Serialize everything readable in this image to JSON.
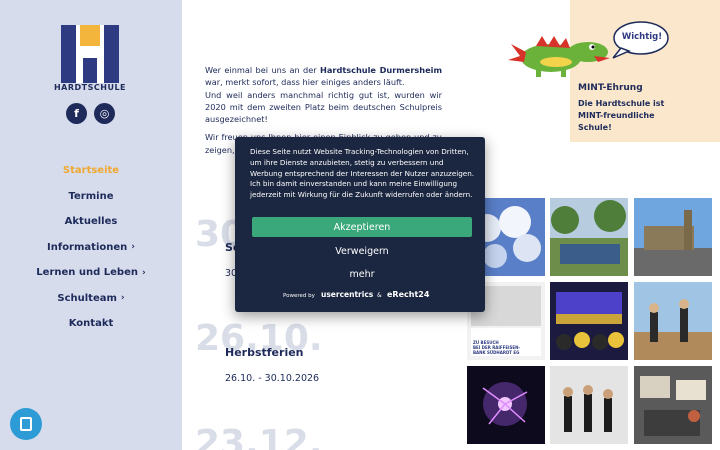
{
  "sidebar": {
    "logo_text": "HARDTSCHULE",
    "social": [
      {
        "icon": "facebook-icon",
        "glyph": "f"
      },
      {
        "icon": "instagram-icon",
        "glyph": "◎"
      }
    ],
    "nav": [
      {
        "label": "Startseite",
        "active": true,
        "has_submenu": false
      },
      {
        "label": "Termine",
        "active": false,
        "has_submenu": false
      },
      {
        "label": "Aktuelles",
        "active": false,
        "has_submenu": false
      },
      {
        "label": "Informationen",
        "active": false,
        "has_submenu": true
      },
      {
        "label": "Lernen und Leben",
        "active": false,
        "has_submenu": true
      },
      {
        "label": "Schulteam",
        "active": false,
        "has_submenu": true
      },
      {
        "label": "Kontakt",
        "active": false,
        "has_submenu": false
      }
    ],
    "chevron": "›"
  },
  "intro": {
    "p1_before": "Wer einmal bei uns an der ",
    "p1_bold": "Hardtschule Durmersheim",
    "p1_after": " war, merkt sofort, dass hier einiges anders läuft.",
    "p2": "Und weil anders manchmal richtig gut ist, wurden wir 2020 mit dem zweiten Platz beim deutschen Schulpreis ausgezeichnet!",
    "p3": "Wir freuen uns Ihnen hier einen Einblick zu geben und zu zeigen, w"
  },
  "events": [
    {
      "big": "30",
      "title": "Sc",
      "dates": "30"
    },
    {
      "big": "26.10.",
      "title": "Herbstferien",
      "dates": "26.10. - 30.10.2026"
    },
    {
      "big": "23.12.",
      "title": "",
      "dates": ""
    }
  ],
  "mint": {
    "bubble": "Wichtig!",
    "title": "MINT-Ehrung",
    "subtitle": "Die Hardtschule ist MINT-freundliche Schule!"
  },
  "photo_badge": {
    "line1": "ZU BESUCH",
    "line2": "BEI DER RAIFFEISEN-",
    "line3": "BANK SÜDHARDT EG"
  },
  "cookie": {
    "text": "Diese Seite nutzt Website Tracking-Technologien von Dritten, um ihre Dienste anzubieten, stetig zu verbessern und Werbung entsprechend der Interessen der Nutzer anzuzeigen. Ich bin damit einverstanden und kann meine Einwilligung jederzeit mit Wirkung für die Zukunft widerrufen oder ändern.",
    "accept": "Akzeptieren",
    "deny": "Verweigern",
    "more": "mehr",
    "powered_by": "Powered by",
    "usercentrics": "usercentrics",
    "amp": "&",
    "erecht": "eRecht24"
  },
  "colors": {
    "navy": "#1d2a5a",
    "accent_orange": "#f0a830",
    "sidebar_bg": "#d6dcec",
    "accept_green": "#3aa87a",
    "modal_bg": "#1b2740",
    "mint_panel": "#fbe8cc"
  }
}
